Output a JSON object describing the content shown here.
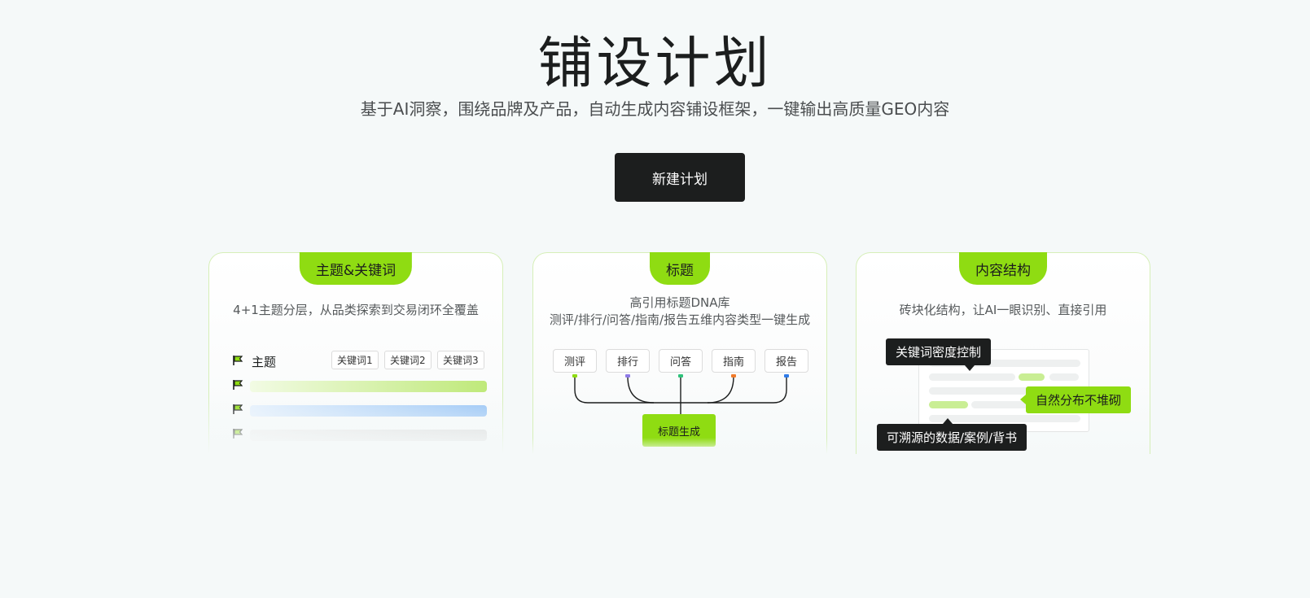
{
  "hero": {
    "title": "铺设计划",
    "subtitle": "基于AI洞察，围绕品牌及产品，自动生成内容铺设框架，一键输出高质量GEO内容",
    "cta_label": "新建计划"
  },
  "cards": [
    {
      "tab": "主题&关键词",
      "desc": "4+1主题分层，从品类探索到交易闭环全覆盖",
      "topic_label": "主题",
      "keywords": [
        "关键词1",
        "关键词2",
        "关键词3"
      ],
      "icon": "flag-icon"
    },
    {
      "tab": "标题",
      "desc_line1": "高引用标题DNA库",
      "desc_line2": "测评/排行/问答/指南/报告五维内容类型一键生成",
      "chips": [
        "测评",
        "排行",
        "问答",
        "指南",
        "报告"
      ],
      "chip_colors": [
        "#8fdc12",
        "#8f7be8",
        "#2fc27a",
        "#f07b2c",
        "#2f7be8"
      ],
      "generate_label": "标题生成"
    },
    {
      "tab": "内容结构",
      "desc": "砖块化结构，让AI一眼识别、直接引用",
      "tip_keyword": "关键词密度控制",
      "tip_natural": "自然分布不堆砌",
      "tip_traceable": "可溯源的数据/案例/背书"
    }
  ],
  "colors": {
    "accent": "#8fdc12",
    "dark": "#1c1e1e",
    "background": "#f5f9f9"
  }
}
